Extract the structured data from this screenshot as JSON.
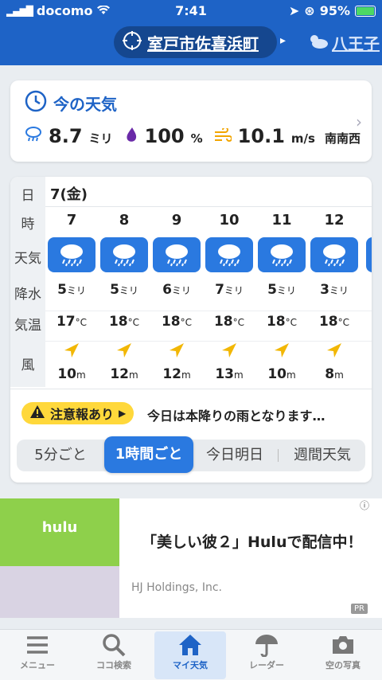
{
  "status_bar": {
    "carrier": "docomo",
    "time": "7:41",
    "battery": "95%"
  },
  "header": {
    "current_location": "室戸市佐喜浜町",
    "next_location": "八王子"
  },
  "now": {
    "title": "今の天気",
    "precip_value": "8.7",
    "precip_unit": "ミリ",
    "humidity_value": "100",
    "humidity_unit": "%",
    "wind_value": "10.1",
    "wind_unit": "m/s",
    "wind_dir": "南南西"
  },
  "hourly": {
    "row_labels": {
      "day": "日",
      "hour": "時",
      "weather": "天気",
      "precip": "降水",
      "temp": "気温",
      "wind": "風"
    },
    "day": "7(金)",
    "hours": [
      {
        "hour": "7",
        "precip": "5",
        "temp": "17",
        "wind": "10",
        "weather": "rain-cloud-icon"
      },
      {
        "hour": "8",
        "precip": "5",
        "temp": "18",
        "wind": "12",
        "weather": "rain-cloud-icon"
      },
      {
        "hour": "9",
        "precip": "6",
        "temp": "18",
        "wind": "12",
        "weather": "rain-cloud-icon"
      },
      {
        "hour": "10",
        "precip": "7",
        "temp": "18",
        "wind": "13",
        "weather": "rain-cloud-icon"
      },
      {
        "hour": "11",
        "precip": "5",
        "temp": "18",
        "wind": "10",
        "weather": "rain-cloud-icon"
      },
      {
        "hour": "12",
        "precip": "3",
        "temp": "18",
        "wind": "8",
        "weather": "rain-cloud-icon"
      }
    ],
    "precip_unit": "ミリ",
    "temp_unit": "°C",
    "wind_unit": "m"
  },
  "alert": {
    "badge": "注意報あり",
    "text": "今日は本降りの雨となります…"
  },
  "segments": [
    "5分ごと",
    "1時間ごと",
    "今日明日",
    "週間天気"
  ],
  "ad": {
    "brand": "hulu",
    "title": "「美しい彼２」Huluで配信中！",
    "sponsor": "HJ Holdings, Inc.",
    "pr": "PR",
    "info": "ⓘ"
  },
  "nav": [
    {
      "label": "メニュー"
    },
    {
      "label": "ココ検索"
    },
    {
      "label": "マイ天気"
    },
    {
      "label": "レーダー"
    },
    {
      "label": "空の写真"
    }
  ],
  "colors": {
    "primary": "#1e63c6",
    "accent": "#2a79e0",
    "alert": "#ffd83b",
    "wind_arrow": "#f2b705"
  }
}
